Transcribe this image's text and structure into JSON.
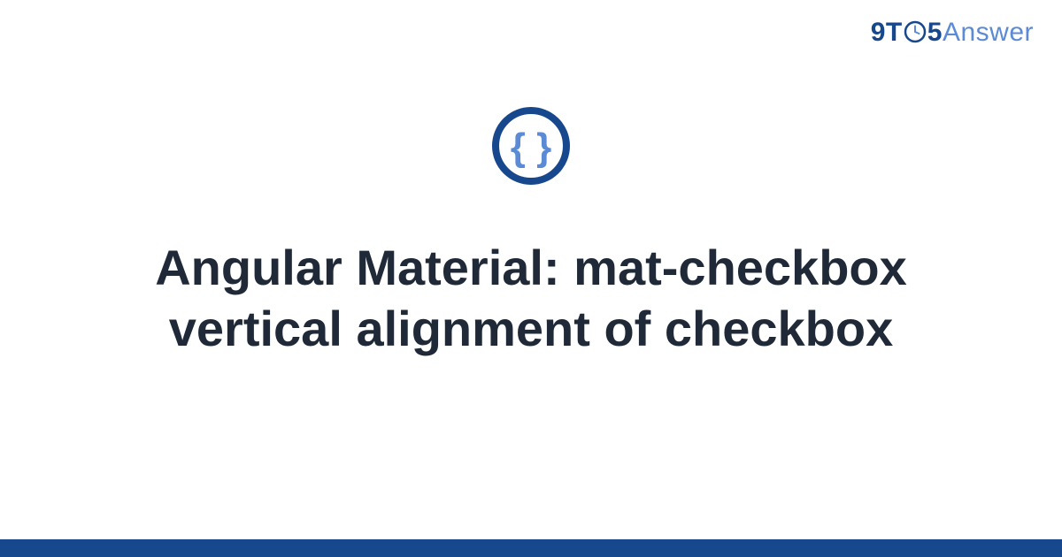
{
  "logo": {
    "part1": "9T",
    "part2": "5",
    "part3": "Answer"
  },
  "title": "Angular Material: mat-checkbox vertical alignment of checkbox",
  "colors": {
    "primary_dark": "#17478c",
    "primary_light": "#5b8bd4",
    "text": "#1f2937"
  },
  "icon": {
    "name": "code-braces-icon"
  }
}
